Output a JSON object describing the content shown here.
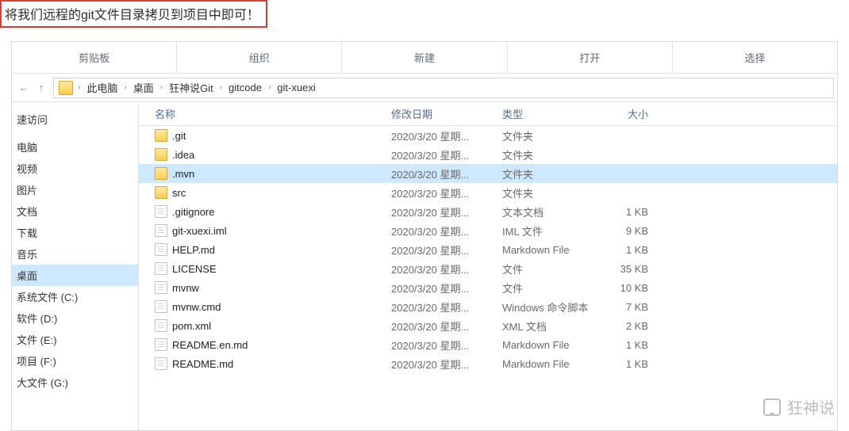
{
  "callout": "将我们远程的git文件目录拷贝到项目中即可！",
  "ribbon": [
    "剪贴板",
    "组织",
    "新建",
    "打开",
    "选择"
  ],
  "nav": {
    "back": "←",
    "up": "↑"
  },
  "breadcrumbs": [
    "此电脑",
    "桌面",
    "狂神说Git",
    "gitcode",
    "git-xuexi"
  ],
  "crumb_sep": "›",
  "columns": {
    "name": "名称",
    "date": "修改日期",
    "type": "类型",
    "size": "大小"
  },
  "sidebar": [
    {
      "label": "速访问",
      "selected": false
    },
    {
      "label": "",
      "selected": false
    },
    {
      "label": "电脑",
      "selected": false
    },
    {
      "label": "视频",
      "selected": false
    },
    {
      "label": "图片",
      "selected": false
    },
    {
      "label": "文档",
      "selected": false
    },
    {
      "label": "下载",
      "selected": false
    },
    {
      "label": "音乐",
      "selected": false
    },
    {
      "label": "桌面",
      "selected": true
    },
    {
      "label": "系统文件 (C:)",
      "selected": false
    },
    {
      "label": "软件 (D:)",
      "selected": false
    },
    {
      "label": "文件 (E:)",
      "selected": false
    },
    {
      "label": "项目 (F:)",
      "selected": false
    },
    {
      "label": "大文件 (G:)",
      "selected": false
    }
  ],
  "files": [
    {
      "name": ".git",
      "date": "2020/3/20 星期...",
      "type": "文件夹",
      "size": "",
      "icon": "folder",
      "selected": false
    },
    {
      "name": ".idea",
      "date": "2020/3/20 星期...",
      "type": "文件夹",
      "size": "",
      "icon": "folder",
      "selected": false
    },
    {
      "name": ".mvn",
      "date": "2020/3/20 星期...",
      "type": "文件夹",
      "size": "",
      "icon": "folder",
      "selected": true
    },
    {
      "name": "src",
      "date": "2020/3/20 星期...",
      "type": "文件夹",
      "size": "",
      "icon": "folder",
      "selected": false
    },
    {
      "name": ".gitignore",
      "date": "2020/3/20 星期...",
      "type": "文本文档",
      "size": "1 KB",
      "icon": "file",
      "selected": false
    },
    {
      "name": "git-xuexi.iml",
      "date": "2020/3/20 星期...",
      "type": "IML 文件",
      "size": "9 KB",
      "icon": "file",
      "selected": false
    },
    {
      "name": "HELP.md",
      "date": "2020/3/20 星期...",
      "type": "Markdown File",
      "size": "1 KB",
      "icon": "file",
      "selected": false
    },
    {
      "name": "LICENSE",
      "date": "2020/3/20 星期...",
      "type": "文件",
      "size": "35 KB",
      "icon": "file",
      "selected": false
    },
    {
      "name": "mvnw",
      "date": "2020/3/20 星期...",
      "type": "文件",
      "size": "10 KB",
      "icon": "file",
      "selected": false
    },
    {
      "name": "mvnw.cmd",
      "date": "2020/3/20 星期...",
      "type": "Windows 命令脚本",
      "size": "7 KB",
      "icon": "file",
      "selected": false
    },
    {
      "name": "pom.xml",
      "date": "2020/3/20 星期...",
      "type": "XML 文档",
      "size": "2 KB",
      "icon": "file",
      "selected": false
    },
    {
      "name": "README.en.md",
      "date": "2020/3/20 星期...",
      "type": "Markdown File",
      "size": "1 KB",
      "icon": "file",
      "selected": false
    },
    {
      "name": "README.md",
      "date": "2020/3/20 星期...",
      "type": "Markdown File",
      "size": "1 KB",
      "icon": "file",
      "selected": false
    }
  ],
  "watermark": "狂神说"
}
